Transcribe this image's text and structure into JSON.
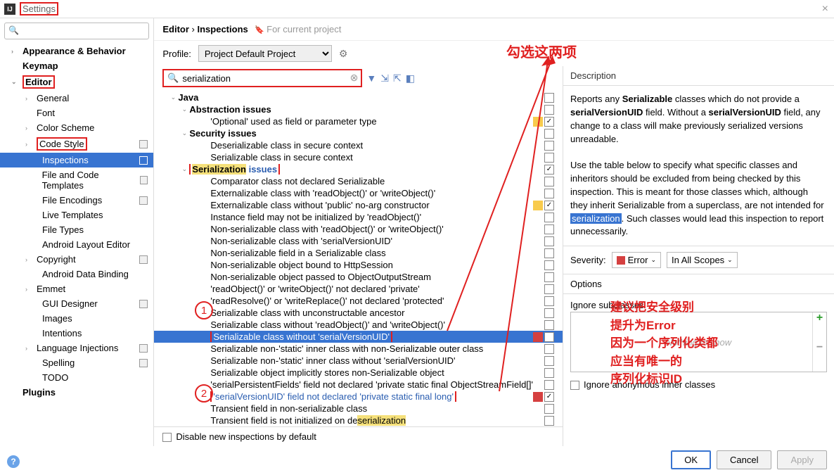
{
  "window": {
    "title": "Settings"
  },
  "crumbs": {
    "a": "Editor",
    "b": "Inspections",
    "scope": "For current project"
  },
  "profile": {
    "label": "Profile:",
    "value": "Project Default  Project"
  },
  "search": {
    "placeholder": ""
  },
  "tree": [
    {
      "l": 1,
      "arr": "›",
      "label": "Appearance & Behavior"
    },
    {
      "l": 1,
      "arr": "",
      "label": "Keymap"
    },
    {
      "l": 1,
      "arr": "⌄",
      "label": "Editor",
      "red": true
    },
    {
      "l": 2,
      "arr": "›",
      "label": "General"
    },
    {
      "l": 2,
      "arr": "",
      "label": "Font"
    },
    {
      "l": 2,
      "arr": "›",
      "label": "Color Scheme"
    },
    {
      "l": 2,
      "arr": "›",
      "label": "Code Style",
      "mark": true,
      "red": true
    },
    {
      "l": 3,
      "arr": "",
      "label": "Inspections",
      "sel": true,
      "mark": true
    },
    {
      "l": 3,
      "arr": "",
      "label": "File and Code Templates",
      "mark": true
    },
    {
      "l": 3,
      "arr": "",
      "label": "File Encodings",
      "mark": true
    },
    {
      "l": 3,
      "arr": "",
      "label": "Live Templates"
    },
    {
      "l": 3,
      "arr": "",
      "label": "File Types"
    },
    {
      "l": 3,
      "arr": "",
      "label": "Android Layout Editor"
    },
    {
      "l": 2,
      "arr": "›",
      "label": "Copyright",
      "mark": true
    },
    {
      "l": 3,
      "arr": "",
      "label": "Android Data Binding"
    },
    {
      "l": 2,
      "arr": "›",
      "label": "Emmet"
    },
    {
      "l": 3,
      "arr": "",
      "label": "GUI Designer",
      "mark": true
    },
    {
      "l": 3,
      "arr": "",
      "label": "Images"
    },
    {
      "l": 3,
      "arr": "",
      "label": "Intentions"
    },
    {
      "l": 2,
      "arr": "›",
      "label": "Language Injections",
      "mark": true
    },
    {
      "l": 3,
      "arr": "",
      "label": "Spelling",
      "mark": true
    },
    {
      "l": 3,
      "arr": "",
      "label": "TODO"
    },
    {
      "l": 1,
      "arr": "",
      "label": "Plugins"
    }
  ],
  "insp_search": "serialization",
  "insp": [
    {
      "ind": 20,
      "arr": "⌄",
      "b": true,
      "t": "Java"
    },
    {
      "ind": 36,
      "arr": "⌄",
      "b": true,
      "t": "Abstraction issues"
    },
    {
      "ind": 66,
      "t": "'Optional' used as field or parameter type",
      "sw": "sw-yellow",
      "ck": true
    },
    {
      "ind": 36,
      "arr": "⌄",
      "b": true,
      "t": "Security issues"
    },
    {
      "ind": 66,
      "t": "Deserializable class in secure context"
    },
    {
      "ind": 66,
      "t": "Serializable class in secure context"
    },
    {
      "ind": 36,
      "arr": "⌄",
      "b": true,
      "t": "<span class='hl'>Serialization</span> <span class='blue-link'>issues</span>",
      "red": true,
      "ck": true
    },
    {
      "ind": 66,
      "t": "Comparator class not declared Serializable"
    },
    {
      "ind": 66,
      "t": "Externalizable class with 'readObject()' or 'writeObject()'"
    },
    {
      "ind": 66,
      "t": "Externalizable class without 'public' no-arg constructor",
      "sw": "sw-yellow",
      "ck": true
    },
    {
      "ind": 66,
      "t": "Instance field may not be initialized by 'readObject()'"
    },
    {
      "ind": 66,
      "t": "Non-serializable class with 'readObject()' or 'writeObject()'"
    },
    {
      "ind": 66,
      "t": "Non-serializable class with 'serialVersionUID'"
    },
    {
      "ind": 66,
      "t": "Non-serializable field in a Serializable class"
    },
    {
      "ind": 66,
      "t": "Non-serializable object bound to HttpSession"
    },
    {
      "ind": 66,
      "t": "Non-serializable object passed to ObjectOutputStream"
    },
    {
      "ind": 66,
      "t": "'readObject()' or 'writeObject()' not declared 'private'"
    },
    {
      "ind": 66,
      "t": "'readResolve()' or 'writeReplace()' not declared 'protected'"
    },
    {
      "ind": 66,
      "t": "Serializable class with unconstructable ancestor"
    },
    {
      "ind": 66,
      "t": "Serializable class without 'readObject()' and 'writeObject()'"
    },
    {
      "ind": 66,
      "t": "Serializable class without 'serialVersionUID'",
      "sel": true,
      "sw": "sw-red",
      "ck": true,
      "red": true
    },
    {
      "ind": 66,
      "t": "Serializable non-'static' inner class with non-Serializable outer class"
    },
    {
      "ind": 66,
      "t": "Serializable non-'static' inner class without 'serialVersionUID'"
    },
    {
      "ind": 66,
      "t": "Serializable object implicitly stores non-Serializable object"
    },
    {
      "ind": 66,
      "t": "'serialPersistentFields' field not declared 'private static final ObjectStreamField[]'"
    },
    {
      "ind": 66,
      "t": "<span class='blue-link'>'serialVersionUID' field not declared 'private static final long'</span>",
      "sw": "sw-red",
      "ck": true,
      "red": true
    },
    {
      "ind": 66,
      "t": "Transient field in non-serializable class"
    },
    {
      "ind": 66,
      "t": "Transient field is not initialized on de<span class='hl'>serialization</span>"
    }
  ],
  "foot": "Disable new inspections by default",
  "desc": {
    "head": "Description",
    "body": "Reports any <b>Serializable</b> classes which do not provide a <b>serialVersionUID</b> field. Without a <b>serialVersionUID</b> field, any change to a class will make previously serialized versions unreadable.<br><br>Use the table below to specify what specific classes and inheritors should be excluded from being checked by this inspection. This is meant for those classes which, although they inherit Serializable from a superclass, are not intended for <span class='serh'>serialization</span>. Such classes would lead this inspection to report unnecessarily."
  },
  "severity": {
    "label": "Severity:",
    "value": "Error",
    "scope": "In All Scopes"
  },
  "options": {
    "head": "Options",
    "ignore_sub": "Ignore subclasses",
    "empty": "Nothing to show",
    "ignore_anon": "Ignore anonymous inner classes"
  },
  "buttons": {
    "ok": "OK",
    "cancel": "Cancel",
    "apply": "Apply"
  },
  "anno": {
    "top": "勾选这两项",
    "right": "建议把安全级别\n提升为Error\n因为一个序列化类都\n应当有唯一的\n序列化标识ID"
  }
}
